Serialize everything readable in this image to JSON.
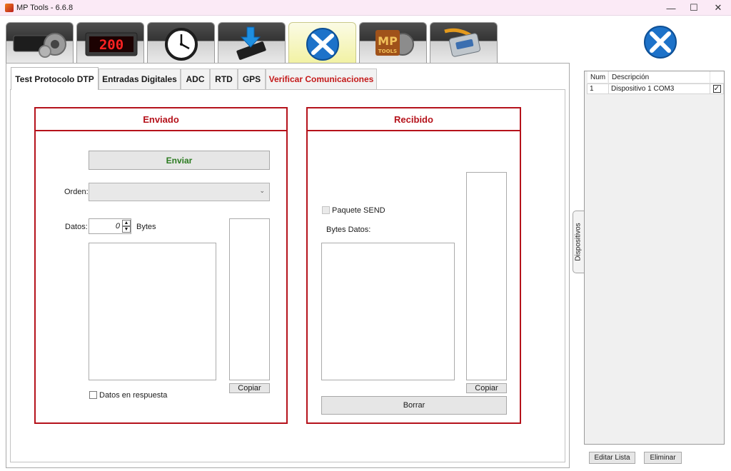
{
  "window": {
    "title": "MP Tools - 6.6.8",
    "controls": {
      "minimize": "—",
      "maximize": "☐",
      "close": "✕"
    }
  },
  "main_tabs": [
    {
      "icon": "gear-panel-icon",
      "active": false
    },
    {
      "icon": "led-display-icon",
      "led_text": "200",
      "active": false
    },
    {
      "icon": "clock-icon",
      "active": false
    },
    {
      "icon": "chip-download-icon",
      "active": false
    },
    {
      "icon": "tools-icon",
      "active": true
    },
    {
      "icon": "mp-tools-logo-icon",
      "active": false
    },
    {
      "icon": "serial-cable-icon",
      "active": false
    }
  ],
  "sub_tabs": [
    {
      "label": "Test Protocolo DTP",
      "active": true,
      "highlight": false
    },
    {
      "label": "Entradas Digitales",
      "active": false,
      "highlight": false
    },
    {
      "label": "ADC",
      "active": false,
      "highlight": false
    },
    {
      "label": "RTD",
      "active": false,
      "highlight": false
    },
    {
      "label": "GPS",
      "active": false,
      "highlight": false
    },
    {
      "label": "Verificar Comunicaciones",
      "active": false,
      "highlight": true
    }
  ],
  "enviado": {
    "title": "Enviado",
    "send_button": "Enviar",
    "orden_label": "Orden:",
    "orden_value": "",
    "datos_label": "Datos:",
    "datos_value": "0",
    "bytes_label": "Bytes",
    "copy_button": "Copiar",
    "datos_en_respuesta_label": "Datos en respuesta",
    "datos_en_respuesta_checked": false
  },
  "recibido": {
    "title": "Recibido",
    "paquete_send_label": "Paquete SEND",
    "paquete_send_checked": false,
    "bytes_datos_label": "Bytes Datos:",
    "copy_button": "Copiar",
    "clear_button": "Borrar"
  },
  "devices": {
    "side_tab_label": "Dispositivos",
    "columns": [
      "Num",
      "Descripción"
    ],
    "rows": [
      {
        "num": "1",
        "descripcion": "Dispositivo 1 COM3",
        "checked": true
      }
    ],
    "edit_button": "Editar Lista",
    "delete_button": "Eliminar"
  },
  "colors": {
    "accent_red": "#b5121b",
    "send_green": "#2a7a1f",
    "active_tab_yellow": "#f2f2a4"
  }
}
